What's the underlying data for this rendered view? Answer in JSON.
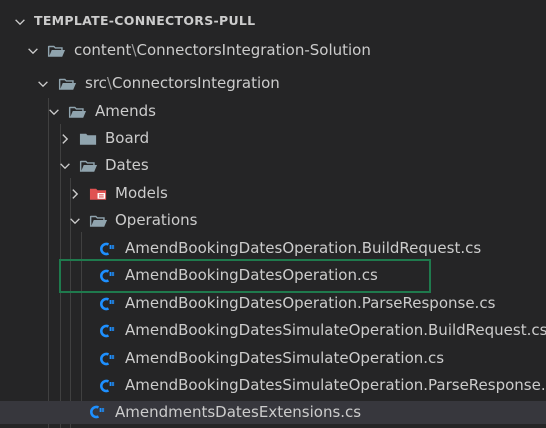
{
  "panel": {
    "title": "TEMPLATE-CONNECTORS-PULL"
  },
  "tree": {
    "content": {
      "part1": "content",
      "sep": "\\",
      "part2": "ConnectorsIntegration-Solution"
    },
    "src": {
      "part1": "src",
      "sep": "\\",
      "part2": "ConnectorsIntegration"
    },
    "amends": "Amends",
    "board": "Board",
    "dates": "Dates",
    "models": "Models",
    "operations": "Operations",
    "files": [
      "AmendBookingDatesOperation.BuildRequest.cs",
      "AmendBookingDatesOperation.cs",
      "AmendBookingDatesOperation.ParseResponse.cs",
      "AmendBookingDatesSimulateOperation.BuildRequest.cs",
      "AmendBookingDatesSimulateOperation.cs",
      "AmendBookingDatesSimulateOperation.ParseResponse.cs"
    ],
    "extensions_file": "AmendmentsDatesExtensions.cs"
  },
  "icons": {
    "folder": "folder-icon",
    "folder_open": "folder-open-icon",
    "models_folder": "models-folder-icon",
    "csharp_file": "csharp-file-icon",
    "chevron_down": "chevron-down-icon",
    "chevron_right": "chevron-right-icon"
  },
  "colors": {
    "background": "#252526",
    "selected_row": "#37373d",
    "highlight_box": "#1f7a4d",
    "csharp_icon": "#1e90ff",
    "models_icon": "#e05252",
    "folder_icon": "#90a4ae"
  }
}
